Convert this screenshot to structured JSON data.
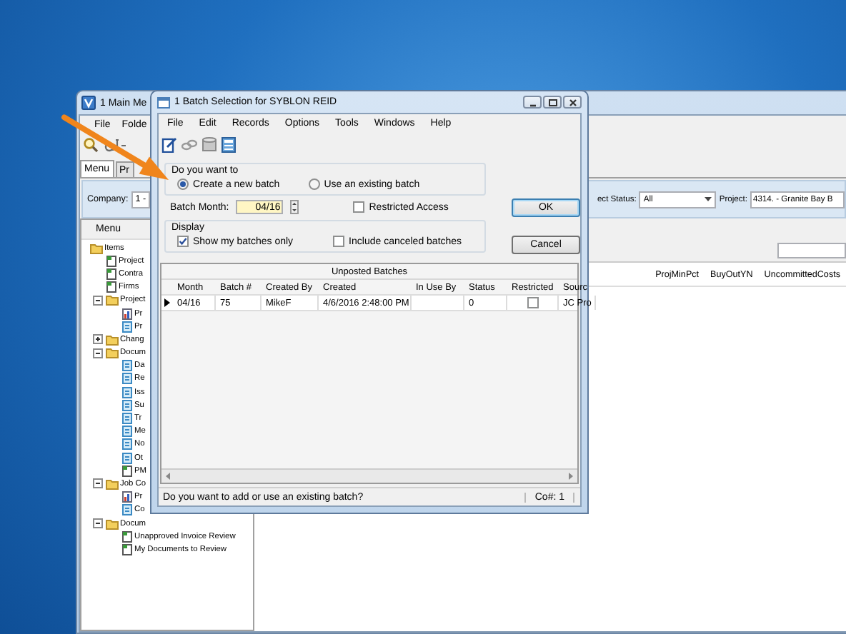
{
  "main_window": {
    "title": "1 Main Me",
    "menu": [
      "File",
      "Folde"
    ],
    "tabs": [
      {
        "label": "Menu",
        "selected": true
      },
      {
        "label": "Pr",
        "selected": false
      }
    ],
    "company": {
      "label": "Company:",
      "value": "1 -"
    },
    "status_filter": {
      "label": "ect Status:",
      "value": "All"
    },
    "project": {
      "label": "Project:",
      "value": "4314. - Granite Bay B"
    },
    "panel_title": "Menu",
    "tree": [
      {
        "label": "Items",
        "kind": "folder",
        "children": [
          {
            "label": "Project",
            "kind": "report"
          },
          {
            "label": "Contra",
            "kind": "report"
          },
          {
            "label": "Firms",
            "kind": "report"
          },
          {
            "label": "Project",
            "kind": "folder",
            "expanded": true,
            "children": [
              {
                "label": "Pr",
                "kind": "chart"
              },
              {
                "label": "Pr",
                "kind": "form"
              }
            ]
          },
          {
            "label": "Chang",
            "kind": "folder",
            "expanded": false
          },
          {
            "label": "Docum",
            "kind": "folder",
            "expanded": true,
            "children": [
              {
                "label": "Da",
                "kind": "form"
              },
              {
                "label": "Re",
                "kind": "form"
              },
              {
                "label": "Iss",
                "kind": "form"
              },
              {
                "label": "Su",
                "kind": "form"
              },
              {
                "label": "Tr",
                "kind": "form"
              },
              {
                "label": "Me",
                "kind": "form"
              },
              {
                "label": "No",
                "kind": "form"
              },
              {
                "label": "Ot",
                "kind": "form"
              },
              {
                "label": "PM",
                "kind": "report"
              }
            ]
          },
          {
            "label": "Job Co",
            "kind": "folder",
            "expanded": true,
            "children": [
              {
                "label": "Pr",
                "kind": "chart"
              },
              {
                "label": "Co",
                "kind": "form"
              }
            ]
          },
          {
            "label": "Docum",
            "kind": "folder",
            "expanded": true,
            "children": [
              {
                "label": "Unapproved Invoice Review",
                "kind": "report"
              },
              {
                "label": "My Documents to Review",
                "kind": "report"
              }
            ]
          }
        ]
      }
    ],
    "columns": [
      "ProjMinPct",
      "BuyOutYN",
      "UncommittedCosts"
    ]
  },
  "dialog": {
    "title": "1 Batch Selection for SYBLON REID",
    "menu": [
      "File",
      "Edit",
      "Records",
      "Options",
      "Tools",
      "Windows",
      "Help"
    ],
    "choice_group": {
      "title": "Do you want to",
      "options": [
        {
          "label": "Create a new batch",
          "selected": true
        },
        {
          "label": "Use an existing batch",
          "selected": false
        }
      ]
    },
    "batch_month": {
      "label": "Batch Month:",
      "value": "04/16"
    },
    "restricted_access": {
      "label": "Restricted Access",
      "checked": false
    },
    "display_group": {
      "title": "Display",
      "options": [
        {
          "label": "Show my batches only",
          "checked": true
        },
        {
          "label": "Include canceled batches",
          "checked": false
        }
      ]
    },
    "buttons": [
      "OK",
      "Cancel"
    ],
    "batches": {
      "title": "Unposted Batches",
      "columns": [
        "Month",
        "Batch #",
        "Created By",
        "Created",
        "In Use By",
        "Status",
        "Restricted",
        "Sourc"
      ],
      "rows": [
        {
          "current": true,
          "month": "04/16",
          "batch": "75",
          "created_by": "MikeF",
          "created": "4/6/2016 2:48:00 PM",
          "status": "0",
          "restricted": false,
          "source": "JC Pro"
        }
      ]
    },
    "status_text": "Do you want to add or use an existing batch?",
    "company_indicator": "Co#: 1"
  }
}
